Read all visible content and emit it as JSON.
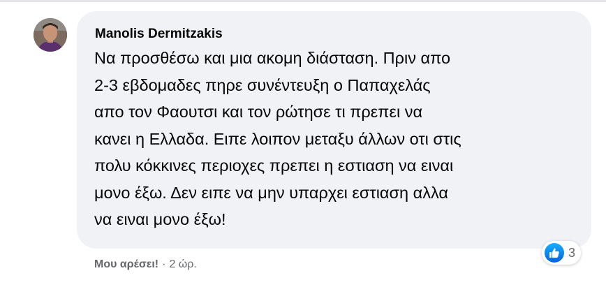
{
  "comment": {
    "author": "Manolis Dermitzakis",
    "text": "Να προσθέσω και μια ακομη διάσταση. Πριν απο\n2-3 εβδομαδες πηρε συνέντευξη ο Παπαχελάς\nαπο τον Φαουτσι και τον ρώτησε τι πρεπει να\nκανει η Ελλαδα. Ειπε λοιπον μεταξυ άλλων οτι στις\nπολυ κόκκινες περιοχες πρεπει η εστιαση να ειναι\nμονο έξω. Δεν ειπε να μην υπαρχει εστιαση αλλα\nνα ειναι μονο έξω!",
    "reactions": {
      "icon": "like-icon",
      "count": "3"
    },
    "actions": {
      "like_label": "Μου αρέσει!",
      "separator": "·",
      "timestamp": "2 ώρ."
    }
  },
  "colors": {
    "bubble": "#f0f2f5",
    "secondary_text": "#65676b",
    "like_blue": "#1877f2"
  }
}
